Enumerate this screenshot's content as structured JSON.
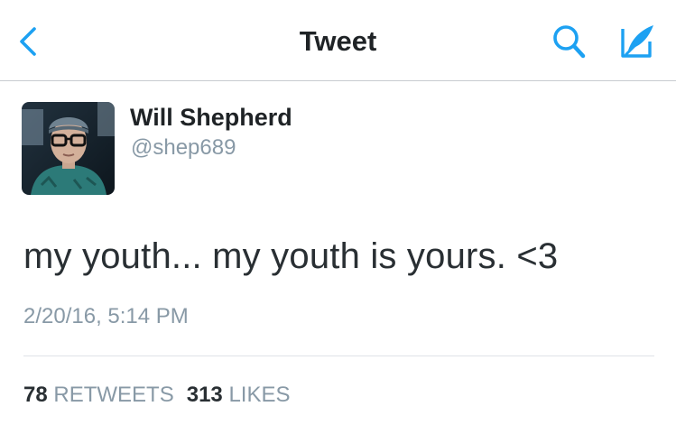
{
  "navbar": {
    "title": "Tweet",
    "back_icon": "chevron-left-icon",
    "search_icon": "search-icon",
    "compose_icon": "compose-tweet-icon",
    "accent_color": "#1da1f2"
  },
  "tweet": {
    "author": {
      "name": "Will Shepherd",
      "handle": "@shep689"
    },
    "text": "my youth... my youth is yours. <3",
    "timestamp": "2/20/16, 5:14 PM",
    "stats": {
      "retweets_count": "78",
      "retweets_label": "RETWEETS",
      "likes_count": "313",
      "likes_label": "LIKES"
    }
  }
}
